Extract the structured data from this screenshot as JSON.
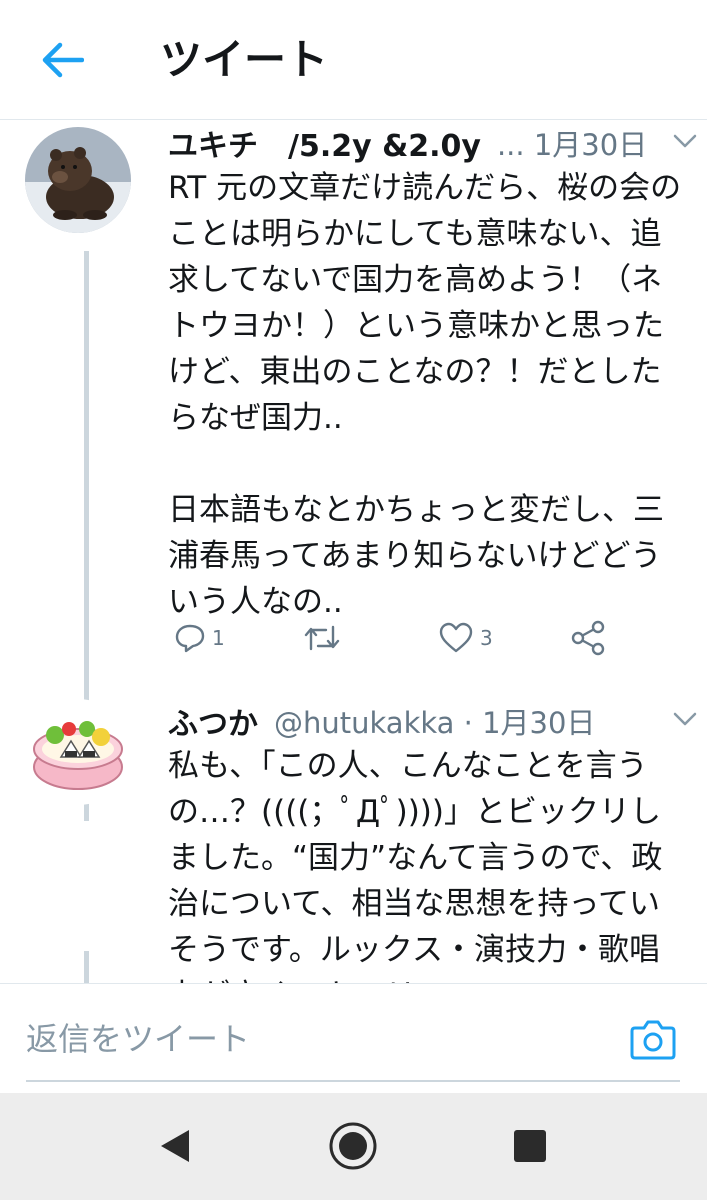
{
  "header": {
    "title": "ツイート"
  },
  "tweets": [
    {
      "display_name": "ユキチ　/5.2y &2.0y",
      "handle_meta": "... 1月30日",
      "text": "RT 元の文章だけ読んだら、桜の会のことは明らかにしても意味ない、追求してないで国力を高めよう！（ネトウヨか！）という意味かと思ったけど、東出のことなの？！だとしたらなぜ国力..\n\n日本語もなとかちょっと変だし、三浦春馬ってあまり知らないけどどういう人なの..",
      "reply_count": "1",
      "like_count": "3"
    },
    {
      "display_name": "ふつか",
      "handle_meta": "@hutukakka · 1月30日",
      "text": "私も、「この人、こんなことを言うの…？((((；ﾟДﾟ))))」とビックリしました。“国力”なんて言うので、政治について、相当な思想を持っていそうです。ルックス・演技力・歌唱力が高く、キャリアの"
    }
  ],
  "reply_bar": {
    "placeholder": "返信をツイート"
  },
  "colors": {
    "accent": "#1da1f2",
    "secondary_text": "#657786",
    "thread_line": "#ccd6dd"
  },
  "icons": [
    "back-arrow-icon",
    "chevron-down-icon",
    "reply-icon",
    "retweet-icon",
    "like-icon",
    "share-icon",
    "camera-icon",
    "nav-back-icon",
    "nav-home-icon",
    "nav-recents-icon"
  ]
}
